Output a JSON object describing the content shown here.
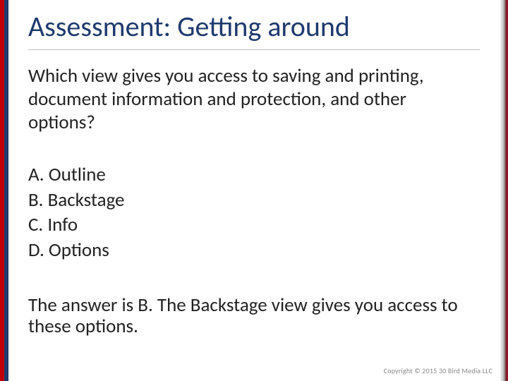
{
  "title": "Assessment: Getting around",
  "question": "Which view gives you access to saving and printing, document information and protection, and other options?",
  "options": {
    "a": "A. Outline",
    "b": "B. Backstage",
    "c": "C. Info",
    "d": "D. Options"
  },
  "answer": "The answer is B. The Backstage view gives you access to these options.",
  "copyright": "Copyright © 2015 30 Bird Media LLC"
}
